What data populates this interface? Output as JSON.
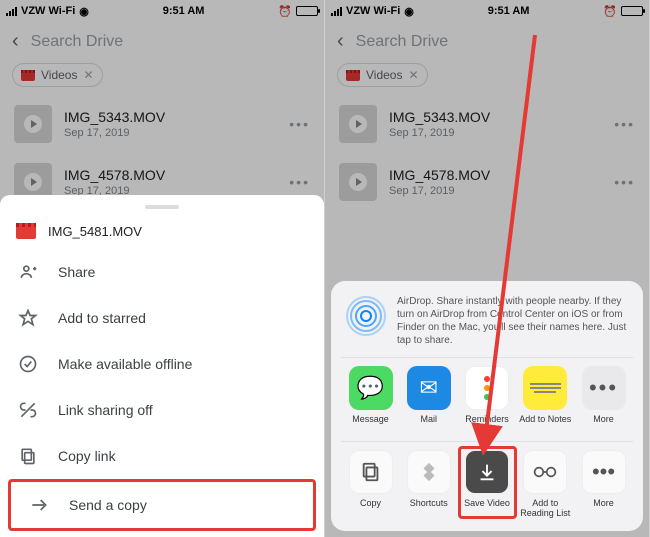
{
  "status": {
    "carrier": "VZW Wi-Fi",
    "time": "9:51 AM"
  },
  "search": {
    "placeholder": "Search Drive"
  },
  "chip": {
    "label": "Videos",
    "close": "✕"
  },
  "files": [
    {
      "name": "IMG_5343.MOV",
      "date": "Sep 17, 2019"
    },
    {
      "name": "IMG_4578.MOV",
      "date": "Sep 17, 2019"
    }
  ],
  "more_dots": "•••",
  "sheet": {
    "filename": "IMG_5481.MOV",
    "actions": {
      "share": "Share",
      "star": "Add to starred",
      "offline": "Make available offline",
      "linkoff": "Link sharing off",
      "copylink": "Copy link",
      "sendcopy": "Send a copy"
    }
  },
  "share_sheet": {
    "airdrop_text": "AirDrop. Share instantly with people nearby. If they turn on AirDrop from Control Center on iOS or from Finder on the Mac, you'll see their names here. Just tap to share.",
    "apps": {
      "message": "Message",
      "mail": "Mail",
      "reminders": "Reminders",
      "notes": "Add to Notes",
      "more": "More"
    },
    "actions": {
      "copy": "Copy",
      "shortcuts": "Shortcuts",
      "savevideo": "Save Video",
      "readinglist": "Add to Reading List",
      "more": "More"
    }
  }
}
